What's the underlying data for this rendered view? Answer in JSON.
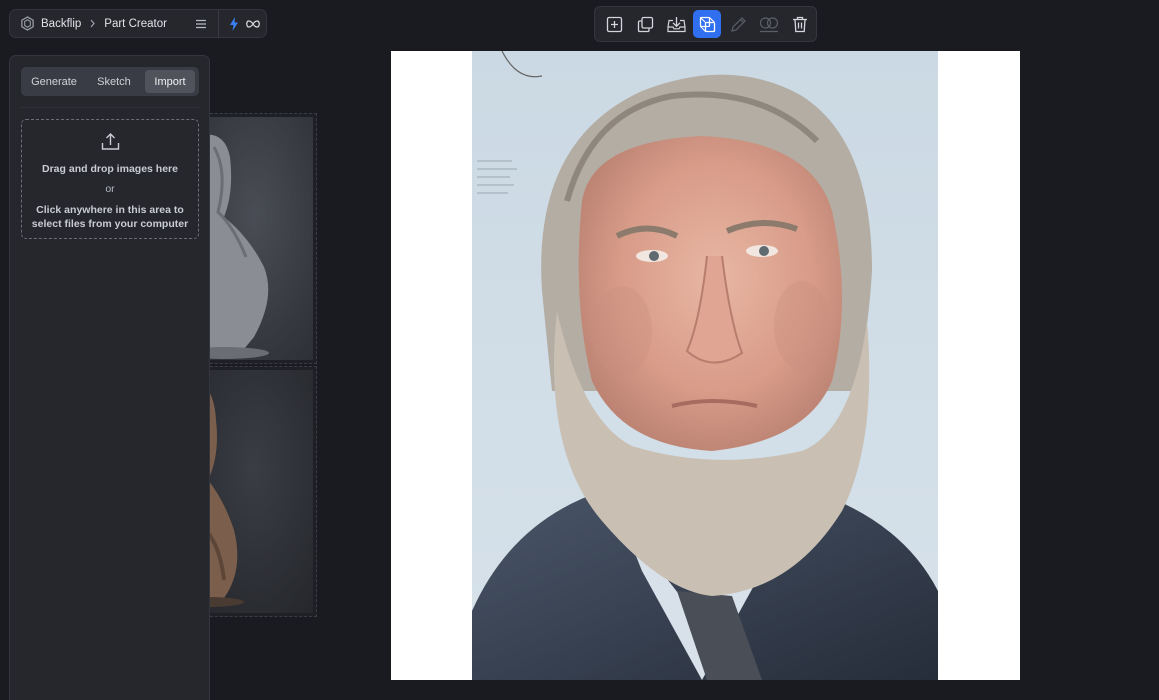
{
  "breadcrumb": {
    "app": "Backflip",
    "page": "Part Creator"
  },
  "toolbar": {
    "tools": [
      {
        "icon": "add-frame-icon",
        "state": "normal"
      },
      {
        "icon": "duplicate-icon",
        "state": "normal"
      },
      {
        "icon": "download-icon",
        "state": "normal"
      },
      {
        "icon": "3d-convert-icon",
        "state": "active"
      },
      {
        "icon": "edit-pencil-icon",
        "state": "disabled"
      },
      {
        "icon": "compare-icon",
        "state": "disabled"
      },
      {
        "icon": "trash-icon",
        "state": "normal"
      }
    ]
  },
  "panel": {
    "tabs": [
      "Generate",
      "Sketch",
      "Import"
    ],
    "active_tab": "Import",
    "dropzone": {
      "line1": "Drag and drop images here",
      "or": "or",
      "line2": "Click anywhere in this area to select files from your computer"
    }
  },
  "colors": {
    "accent": "#2f6ff0",
    "background": "#191b20",
    "panel": "#25272d",
    "bolt": "#3b82f6"
  }
}
